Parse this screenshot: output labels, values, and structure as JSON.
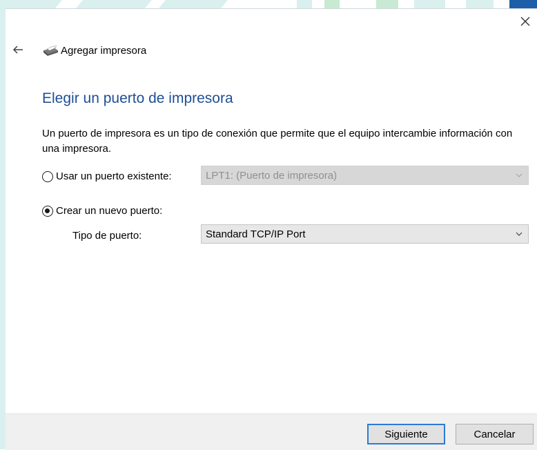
{
  "window": {
    "title": "Agregar impresora",
    "close_icon": "close-icon",
    "back_icon": "back-arrow-icon"
  },
  "page": {
    "heading": "Elegir un puerto de impresora",
    "description": "Un puerto de impresora es un tipo de conexión que permite que el equipo intercambie información con una impresora."
  },
  "options": {
    "existing": {
      "label": "Usar un puerto existente:",
      "selected": false,
      "value": "LPT1: (Puerto de impresora)",
      "enabled": false
    },
    "new": {
      "label": "Crear un nuevo puerto:",
      "selected": true,
      "port_type_label": "Tipo de puerto:",
      "value": "Standard TCP/IP Port",
      "enabled": true
    }
  },
  "footer": {
    "next_label": "Siguiente",
    "cancel_label": "Cancelar"
  },
  "colors": {
    "heading": "#1e4e95",
    "accent": "#2b7bd6",
    "background_stripe": "#d9f0ee",
    "background_stripe_green": "#c8ead2"
  }
}
